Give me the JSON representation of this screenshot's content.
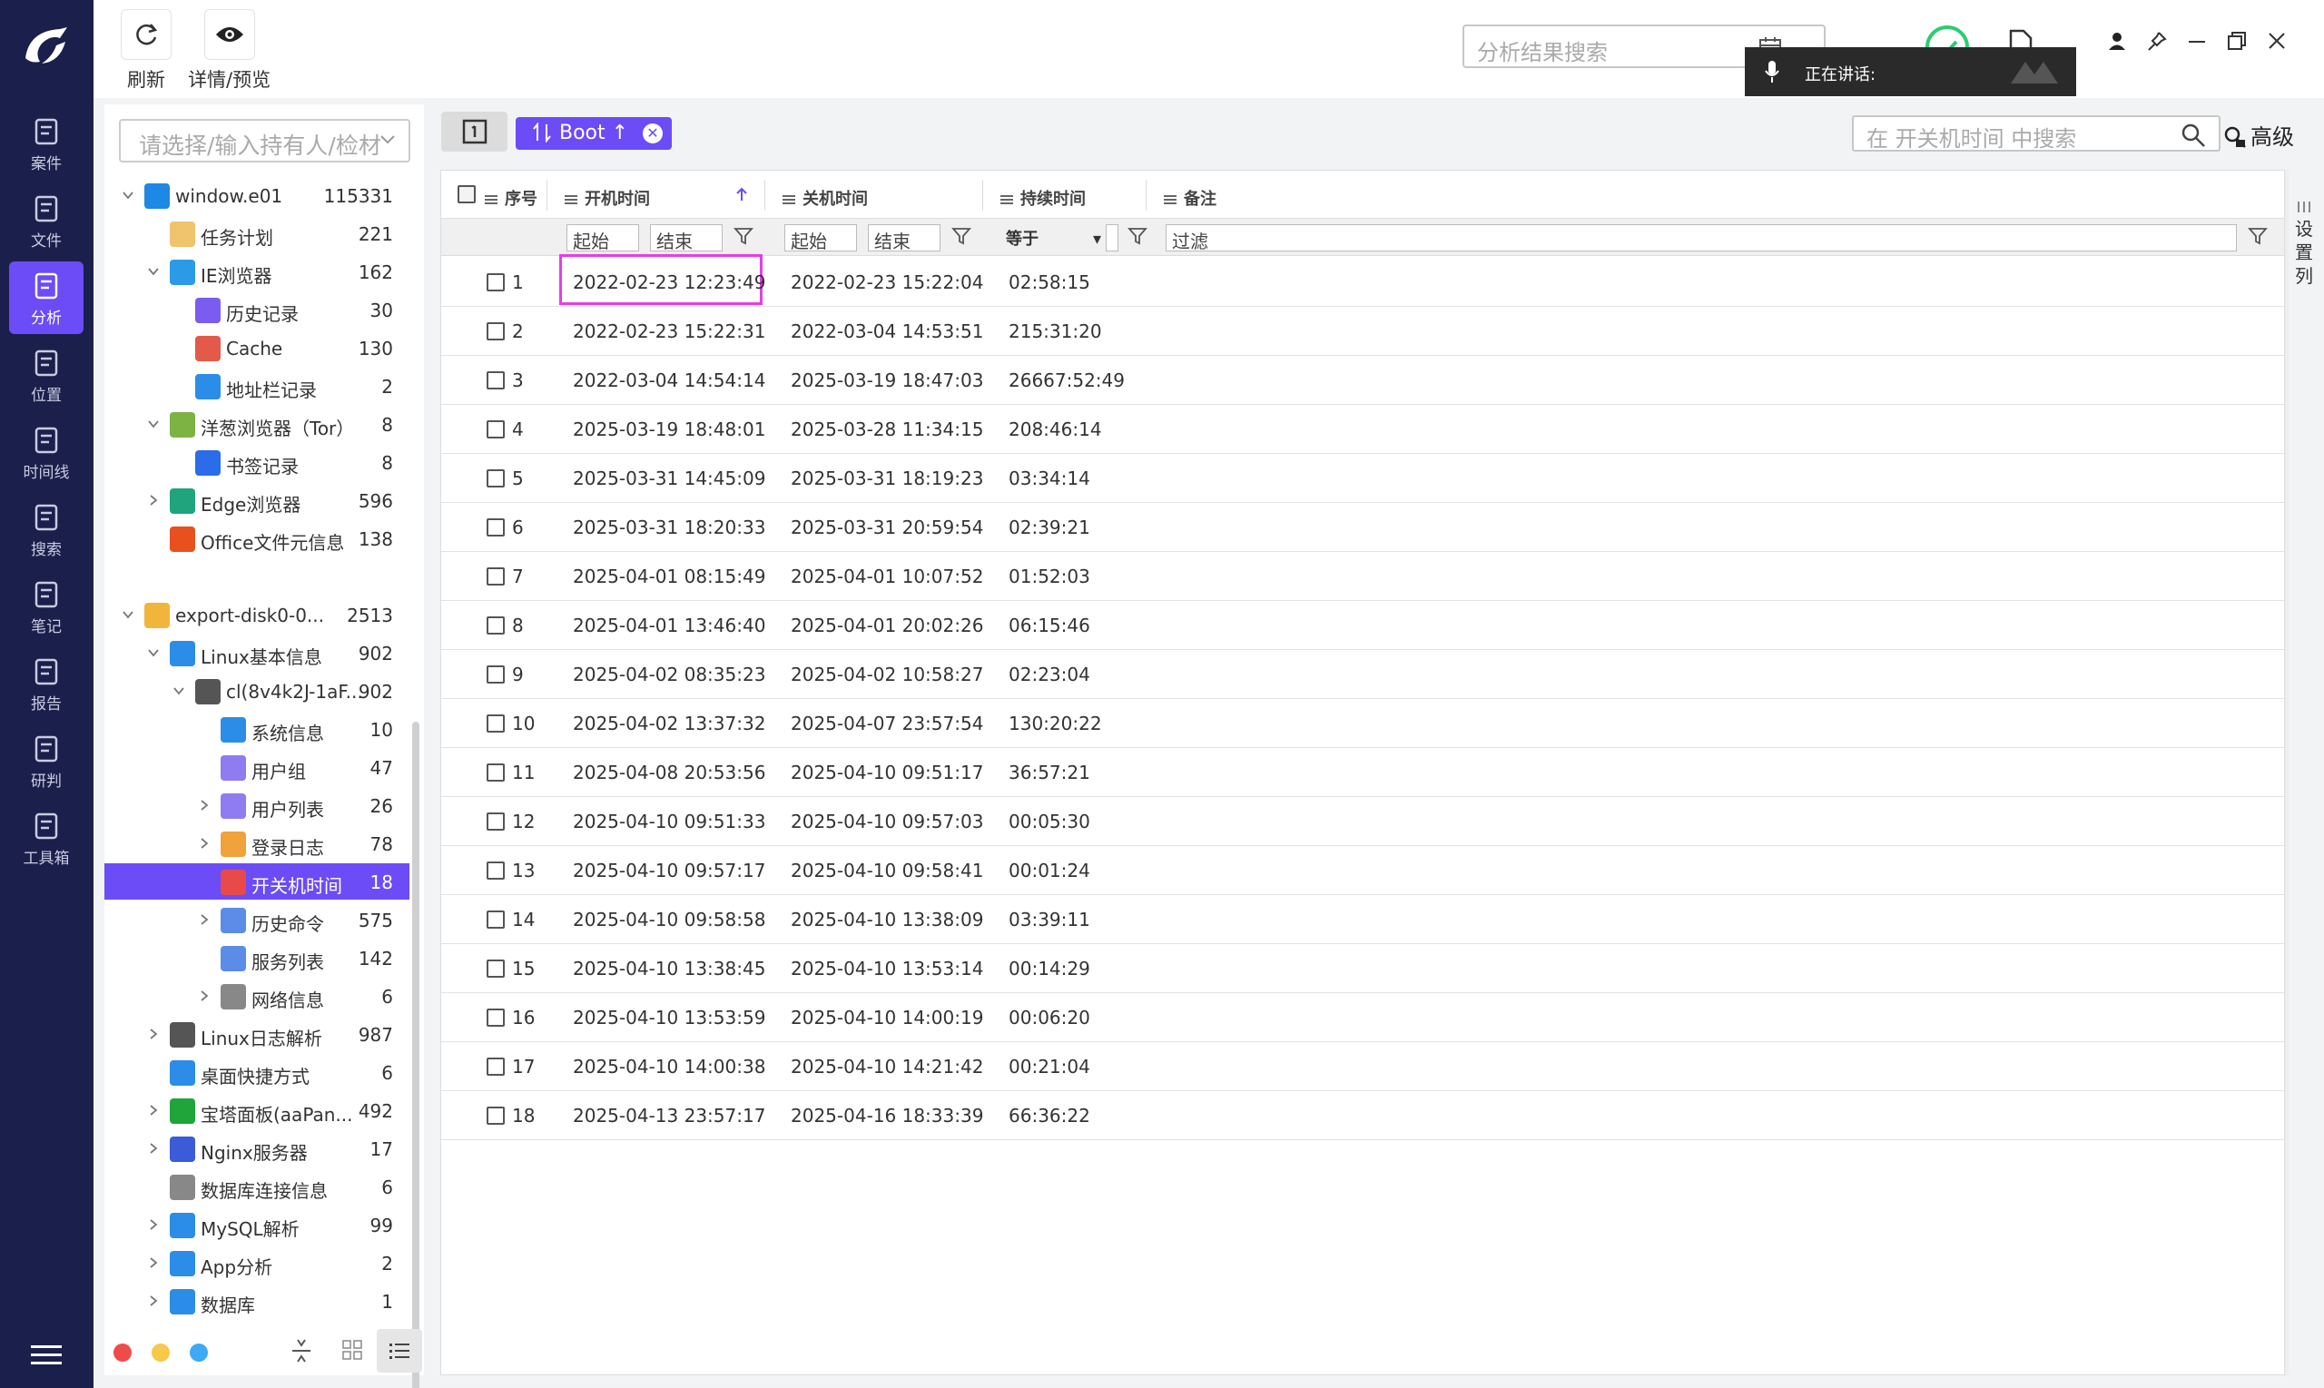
{
  "nav": {
    "items": [
      {
        "label": "案件",
        "icon": "case-icon"
      },
      {
        "label": "文件",
        "icon": "file-icon"
      },
      {
        "label": "分析",
        "icon": "analysis-icon",
        "active": true
      },
      {
        "label": "位置",
        "icon": "location-icon"
      },
      {
        "label": "时间线",
        "icon": "timeline-icon"
      },
      {
        "label": "搜索",
        "icon": "search-icon"
      },
      {
        "label": "笔记",
        "icon": "note-icon"
      },
      {
        "label": "报告",
        "icon": "report-icon"
      },
      {
        "label": "研判",
        "icon": "judge-icon"
      },
      {
        "label": "工具箱",
        "icon": "toolbox-icon"
      }
    ]
  },
  "toolbar": {
    "refresh_label": "刷新",
    "preview_label": "详情/预览",
    "search_placeholder": "分析结果搜索",
    "speaking_label": "正在讲话:"
  },
  "tree": {
    "select_placeholder": "请选择/输入持有人/检材",
    "rows": [
      {
        "label": "window.e01",
        "count": "115331",
        "level": 0,
        "arrow": "down",
        "icon": "windows-icon",
        "color": "#1e88e5"
      },
      {
        "label": "任务计划",
        "count": "221",
        "level": 1,
        "arrow": "",
        "icon": "task-icon",
        "color": "#f0c36d"
      },
      {
        "label": "IE浏览器",
        "count": "162",
        "level": 1,
        "arrow": "down",
        "icon": "ie-icon",
        "color": "#2b9be8"
      },
      {
        "label": "历史记录",
        "count": "30",
        "level": 2,
        "arrow": "",
        "icon": "history-icon",
        "color": "#7b5cf0"
      },
      {
        "label": "Cache",
        "count": "130",
        "level": 2,
        "arrow": "",
        "icon": "cache-icon",
        "color": "#e45a4a"
      },
      {
        "label": "地址栏记录",
        "count": "2",
        "level": 2,
        "arrow": "",
        "icon": "address-icon",
        "color": "#2b8de8"
      },
      {
        "label": "洋葱浏览器（Tor）",
        "count": "8",
        "level": 1,
        "arrow": "down",
        "icon": "tor-icon",
        "color": "#7cb342"
      },
      {
        "label": "书签记录",
        "count": "8",
        "level": 2,
        "arrow": "",
        "icon": "bookmark-icon",
        "color": "#2b6de8"
      },
      {
        "label": "Edge浏览器",
        "count": "596",
        "level": 1,
        "arrow": "right",
        "icon": "edge-icon",
        "color": "#1fa47d"
      },
      {
        "label": "Office文件元信息",
        "count": "138",
        "level": 1,
        "arrow": "",
        "icon": "office-icon",
        "color": "#e8501e"
      },
      {
        "label": "",
        "count": "",
        "level": 0,
        "arrow": "",
        "icon": "",
        "color": ""
      },
      {
        "label": "export-disk0-0...",
        "count": "2513",
        "level": 0,
        "arrow": "down",
        "icon": "linux-icon",
        "color": "#f2b53b"
      },
      {
        "label": "Linux基本信息",
        "count": "902",
        "level": 1,
        "arrow": "down",
        "icon": "linux-info-icon",
        "color": "#2b8de8"
      },
      {
        "label": "cl(8v4k2J-1aF...",
        "count": "902",
        "level": 2,
        "arrow": "down",
        "icon": "disk-icon",
        "color": "#555555"
      },
      {
        "label": "系统信息",
        "count": "10",
        "level": 3,
        "arrow": "",
        "icon": "system-info-icon",
        "color": "#2b8de8"
      },
      {
        "label": "用户组",
        "count": "47",
        "level": 3,
        "arrow": "",
        "icon": "user-group-icon",
        "color": "#8e7cf0"
      },
      {
        "label": "用户列表",
        "count": "26",
        "level": 3,
        "arrow": "right",
        "icon": "user-list-icon",
        "color": "#8e7cf0"
      },
      {
        "label": "登录日志",
        "count": "78",
        "level": 3,
        "arrow": "right",
        "icon": "login-log-icon",
        "color": "#f0a23b"
      },
      {
        "label": "开关机时间",
        "count": "18",
        "level": 3,
        "arrow": "",
        "icon": "power-icon",
        "color": "#e84a4a",
        "selected": true
      },
      {
        "label": "历史命令",
        "count": "575",
        "level": 3,
        "arrow": "right",
        "icon": "command-icon",
        "color": "#5b8de8"
      },
      {
        "label": "服务列表",
        "count": "142",
        "level": 3,
        "arrow": "",
        "icon": "service-icon",
        "color": "#5b8de8"
      },
      {
        "label": "网络信息",
        "count": "6",
        "level": 3,
        "arrow": "right",
        "icon": "network-icon",
        "color": "#888888"
      },
      {
        "label": "Linux日志解析",
        "count": "987",
        "level": 1,
        "arrow": "right",
        "icon": "log-parse-icon",
        "color": "#555555"
      },
      {
        "label": "桌面快捷方式",
        "count": "6",
        "level": 1,
        "arrow": "",
        "icon": "shortcut-icon",
        "color": "#2b8de8"
      },
      {
        "label": "宝塔面板(aaPan...",
        "count": "492",
        "level": 1,
        "arrow": "right",
        "icon": "bt-panel-icon",
        "color": "#20a53a"
      },
      {
        "label": "Nginx服务器",
        "count": "17",
        "level": 1,
        "arrow": "right",
        "icon": "nginx-icon",
        "color": "#3b5bd8"
      },
      {
        "label": "数据库连接信息",
        "count": "6",
        "level": 1,
        "arrow": "",
        "icon": "db-conn-icon",
        "color": "#888888"
      },
      {
        "label": "MySQL解析",
        "count": "99",
        "level": 1,
        "arrow": "right",
        "icon": "mysql-icon",
        "color": "#2b8de8"
      },
      {
        "label": "App分析",
        "count": "2",
        "level": 1,
        "arrow": "right",
        "icon": "app-icon",
        "color": "#2b8de8"
      },
      {
        "label": "数据库",
        "count": "1",
        "level": 1,
        "arrow": "right",
        "icon": "database-icon",
        "color": "#2b8de8"
      }
    ]
  },
  "main": {
    "tag_label": "Boot ↑",
    "search_placeholder": "在 开关机时间 中搜索",
    "advanced_label": "高级",
    "set_columns_label": "设置列",
    "columns": {
      "seq": "序号",
      "boot": "开机时间",
      "shutdown": "关机时间",
      "duration": "持续时间",
      "remark": "备注"
    },
    "filters": {
      "start": "起始",
      "end": "结束",
      "equals": "等于",
      "filter": "过滤"
    },
    "rows": [
      {
        "seq": "1",
        "boot": "2022-02-23 12:23:49",
        "shutdown": "2022-02-23 15:22:04",
        "duration": "02:58:15"
      },
      {
        "seq": "2",
        "boot": "2022-02-23 15:22:31",
        "shutdown": "2022-03-04 14:53:51",
        "duration": "215:31:20"
      },
      {
        "seq": "3",
        "boot": "2022-03-04 14:54:14",
        "shutdown": "2025-03-19 18:47:03",
        "duration": "26667:52:49"
      },
      {
        "seq": "4",
        "boot": "2025-03-19 18:48:01",
        "shutdown": "2025-03-28 11:34:15",
        "duration": "208:46:14"
      },
      {
        "seq": "5",
        "boot": "2025-03-31 14:45:09",
        "shutdown": "2025-03-31 18:19:23",
        "duration": "03:34:14"
      },
      {
        "seq": "6",
        "boot": "2025-03-31 18:20:33",
        "shutdown": "2025-03-31 20:59:54",
        "duration": "02:39:21"
      },
      {
        "seq": "7",
        "boot": "2025-04-01 08:15:49",
        "shutdown": "2025-04-01 10:07:52",
        "duration": "01:52:03"
      },
      {
        "seq": "8",
        "boot": "2025-04-01 13:46:40",
        "shutdown": "2025-04-01 20:02:26",
        "duration": "06:15:46"
      },
      {
        "seq": "9",
        "boot": "2025-04-02 08:35:23",
        "shutdown": "2025-04-02 10:58:27",
        "duration": "02:23:04"
      },
      {
        "seq": "10",
        "boot": "2025-04-02 13:37:32",
        "shutdown": "2025-04-07 23:57:54",
        "duration": "130:20:22"
      },
      {
        "seq": "11",
        "boot": "2025-04-08 20:53:56",
        "shutdown": "2025-04-10 09:51:17",
        "duration": "36:57:21"
      },
      {
        "seq": "12",
        "boot": "2025-04-10 09:51:33",
        "shutdown": "2025-04-10 09:57:03",
        "duration": "00:05:30"
      },
      {
        "seq": "13",
        "boot": "2025-04-10 09:57:17",
        "shutdown": "2025-04-10 09:58:41",
        "duration": "00:01:24"
      },
      {
        "seq": "14",
        "boot": "2025-04-10 09:58:58",
        "shutdown": "2025-04-10 13:38:09",
        "duration": "03:39:11"
      },
      {
        "seq": "15",
        "boot": "2025-04-10 13:38:45",
        "shutdown": "2025-04-10 13:53:14",
        "duration": "00:14:29"
      },
      {
        "seq": "16",
        "boot": "2025-04-10 13:53:59",
        "shutdown": "2025-04-10 14:00:19",
        "duration": "00:06:20"
      },
      {
        "seq": "17",
        "boot": "2025-04-10 14:00:38",
        "shutdown": "2025-04-10 14:21:42",
        "duration": "00:21:04"
      },
      {
        "seq": "18",
        "boot": "2025-04-13 23:57:17",
        "shutdown": "2025-04-16 18:33:39",
        "duration": "66:36:22"
      }
    ]
  },
  "colors": {
    "accent": "#6b4cf6",
    "nav_bg": "#1b1f4b",
    "highlight": "#e83ce8"
  }
}
